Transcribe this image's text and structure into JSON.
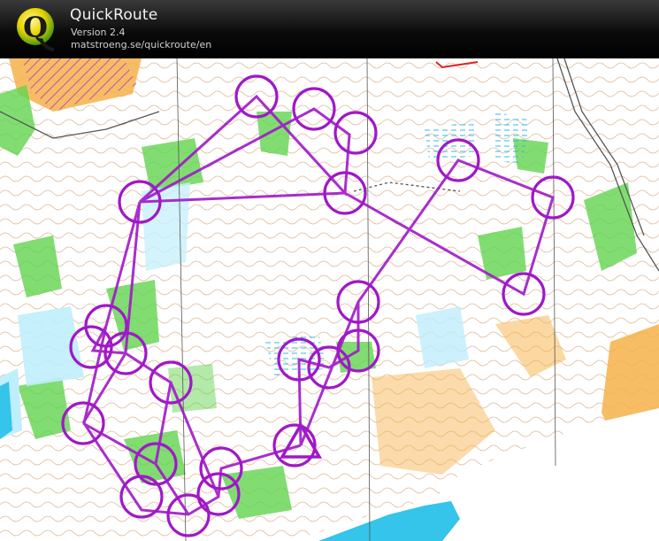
{
  "header": {
    "logo_letter": "Q",
    "title": "QuickRoute",
    "version": "Version 2.4",
    "url": "matstroeng.se/quickroute/en"
  },
  "colors": {
    "course": "#a018c8",
    "lake": "#35c4ea",
    "forest_green": "#5fd24e",
    "open_land": "#f4a628",
    "contour": "#b86a2c",
    "header": "#111111"
  },
  "map": {
    "icon": "orienteering-map",
    "course_controls_count": 20
  }
}
